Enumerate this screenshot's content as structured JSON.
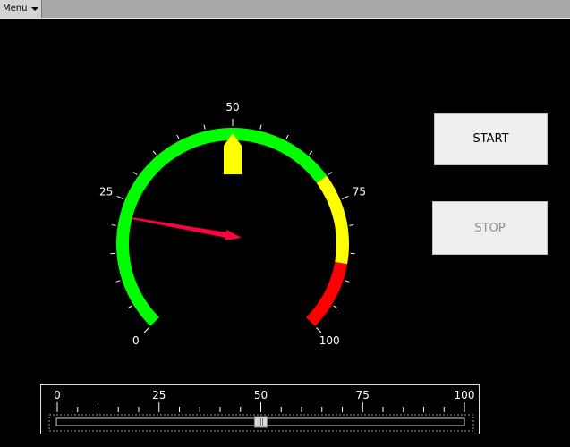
{
  "menubar": {
    "menu_label": "Menu"
  },
  "gauge": {
    "min": 0,
    "max": 100,
    "value": 22,
    "set_point": 50,
    "major_labels": [
      "0",
      "25",
      "50",
      "75",
      "100"
    ],
    "bands": [
      {
        "from": 0,
        "to": 70,
        "color": "#00ff00"
      },
      {
        "from": 70,
        "to": 87,
        "color": "#ffff00"
      },
      {
        "from": 87,
        "to": 100,
        "color": "#ff0000"
      }
    ],
    "needle_color": "#ff0040",
    "marker_color": "#ffff00"
  },
  "buttons": {
    "start_label": "START",
    "stop_label": "STOP"
  },
  "slider": {
    "min": 0,
    "max": 100,
    "value": 50,
    "labels": [
      "0",
      "25",
      "50",
      "75",
      "100"
    ]
  }
}
